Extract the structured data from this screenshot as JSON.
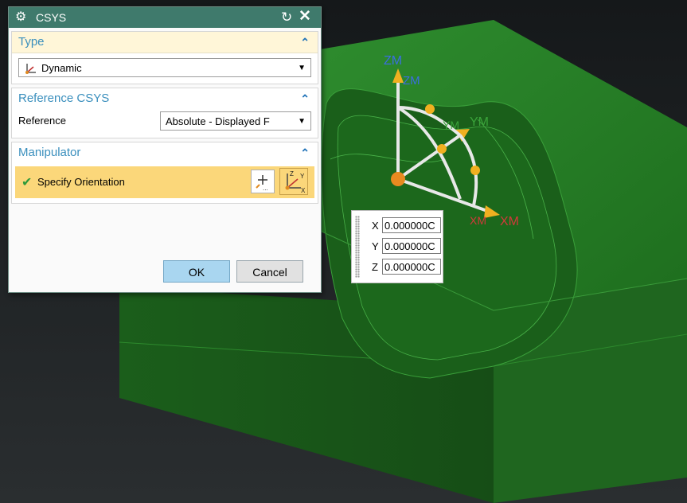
{
  "dialog": {
    "title": "CSYS",
    "icons": {
      "settings": "gear-icon",
      "reset": "reset-icon",
      "close": "close-icon"
    },
    "type_group": {
      "title": "Type",
      "selected": "Dynamic",
      "selected_icon": "dynamic-csys-icon"
    },
    "reference_group": {
      "title": "Reference CSYS",
      "reference_label": "Reference",
      "reference_value": "Absolute - Displayed F"
    },
    "manipulator_group": {
      "title": "Manipulator",
      "specify_orientation": "Specify Orientation",
      "tool_icons": [
        "point-dialog-icon",
        "csys-dialog-icon"
      ]
    },
    "ok_label": "OK",
    "cancel_label": "Cancel"
  },
  "coords_popup": {
    "x_label": "X",
    "x_value": "0.000000C",
    "y_label": "Y",
    "y_value": "0.000000C",
    "z_label": "Z",
    "z_value": "0.000000C"
  },
  "viewport": {
    "axis_labels": {
      "zm_blue": "ZM",
      "zm_green": "ZM",
      "ym_green_a": "YM",
      "ym_green_b": "YM",
      "xm_red_a": "XM",
      "xm_red_b": "XM"
    },
    "colors": {
      "background": "#1d2022",
      "model_green": "#1e7a1e",
      "handle_orange": "#f0a020",
      "dialog_title": "#3f7a6c"
    }
  }
}
